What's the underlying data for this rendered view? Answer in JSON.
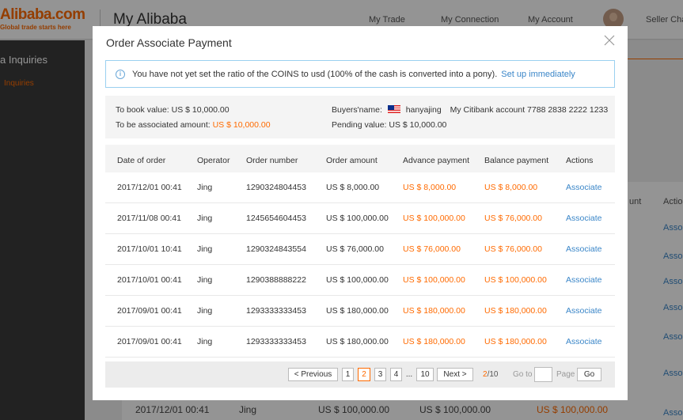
{
  "app": {
    "logo_main": "Alibaba.com",
    "logo_sub": "Global trade starts here",
    "title": "My Alibaba",
    "nav": [
      "My Trade",
      "My Connection",
      "My Account"
    ],
    "seller": "Seller Cha"
  },
  "sidebar": {
    "item1": "a Inquiries",
    "item2": "Inquiries"
  },
  "background": {
    "col_a": "unt",
    "col_b": "Actio",
    "links": [
      "Asso",
      "Asso",
      "Asso",
      "Asso",
      "Asso",
      "Asso",
      "Asso"
    ],
    "row": {
      "date": "2017/12/01 00:41",
      "operator": "Jing",
      "amount1": "US $ 100,000.00",
      "amount2": "US $ 100,000.00",
      "amount3": "US $ 100,000.00",
      "link": "Asso"
    }
  },
  "modal": {
    "title": "Order Associate Payment",
    "notice_text": "You have not yet set the ratio of the COINS to usd (100% of the cash is converted into a pony).",
    "notice_link": "Set up immediately",
    "summary": {
      "book_label": "To book value:",
      "book_value": "US $ 10,000.00",
      "assoc_label": "To be associated amount:",
      "assoc_value": "US $ 10,000.00",
      "buyer_label": "Buyers'name:",
      "buyer_name": "hanyajing",
      "account": "My Citibank account 7788 2838 2222 1233",
      "pending_label": "Pending value:",
      "pending_value": "US $ 10,000.00"
    },
    "table": {
      "headers": [
        "Date of order",
        "Operator",
        "Order number",
        "Order amount",
        "Advance payment",
        "Balance payment",
        "Actions"
      ],
      "rows": [
        [
          "2017/12/01 00:41",
          "Jing",
          "1290324804453",
          "US $ 8,000.00",
          "US $ 8,000.00",
          "US $ 8,000.00",
          "Associate"
        ],
        [
          "2017/11/08 00:41",
          "Jing",
          "1245654604453",
          "US $ 100,000.00",
          "US $ 100,000.00",
          "US $ 76,000.00",
          "Associate"
        ],
        [
          "2017/10/01 10:41",
          "Jing",
          "1290324843554",
          "US $ 76,000.00",
          "US $ 76,000.00",
          "US $ 76,000.00",
          "Associate"
        ],
        [
          "2017/10/01 00:41",
          "Jing",
          "1290388888222",
          "US $ 100,000.00",
          "US $ 100,000.00",
          "US $ 100,000.00",
          "Associate"
        ],
        [
          "2017/09/01 00:41",
          "Jing",
          "1293333333453",
          "US $ 180,000.00",
          "US $ 180,000.00",
          "US $ 180,000.00",
          "Associate"
        ],
        [
          "2017/09/01 00:41",
          "Jing",
          "1293333333453",
          "US $ 180,000.00",
          "US $ 180,000.00",
          "US $ 180,000.00",
          "Associate"
        ]
      ]
    },
    "pager": {
      "previous": "< Previous",
      "pages": [
        "1",
        "2",
        "3",
        "4",
        "...",
        "10"
      ],
      "current": "2",
      "next": "Next >",
      "count_current": "2",
      "count_total": "/10",
      "goto": "Go to",
      "page": "Page",
      "go": "Go"
    }
  },
  "colors": {
    "accent": "#ff6a00",
    "link": "#3a86c8",
    "notice_border": "#9ad0f0"
  }
}
